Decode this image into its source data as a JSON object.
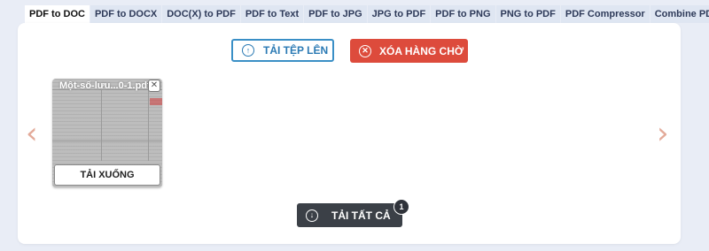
{
  "tabs": [
    {
      "label": "PDF to DOC",
      "active": true
    },
    {
      "label": "PDF to DOCX",
      "active": false
    },
    {
      "label": "DOC(X) to PDF",
      "active": false
    },
    {
      "label": "PDF to Text",
      "active": false
    },
    {
      "label": "PDF to JPG",
      "active": false
    },
    {
      "label": "JPG to PDF",
      "active": false
    },
    {
      "label": "PDF to PNG",
      "active": false
    },
    {
      "label": "PNG to PDF",
      "active": false
    },
    {
      "label": "PDF Compressor",
      "active": false
    },
    {
      "label": "Combine PDF",
      "active": false
    }
  ],
  "actions": {
    "upload_label": "TẢI TỆP LÊN",
    "upload_icon": "upload-arrow-icon",
    "clear_label": "XÓA HÀNG CHỜ",
    "clear_icon": "close-circle-icon",
    "download_all_label": "TẢI TẤT CẢ",
    "download_all_icon": "download-arrow-icon",
    "download_all_count": "1"
  },
  "carousel": {
    "prev_icon": "chevron-left-icon",
    "next_icon": "chevron-right-icon",
    "prev_glyph": "‹",
    "next_glyph": "›"
  },
  "files": [
    {
      "name": "Một-số-lưu...0-1.pdf",
      "download_label": "TẢI XUỐNG",
      "close_icon": "close-icon"
    }
  ],
  "colors": {
    "upload_border": "#3a8fc6",
    "clear_bg": "#dd4b3c",
    "download_all_bg": "#3b4047",
    "arrow": "#e3aa99",
    "active_tab_bg": "#ffffff",
    "tab_bg": "#dfe6f2"
  }
}
